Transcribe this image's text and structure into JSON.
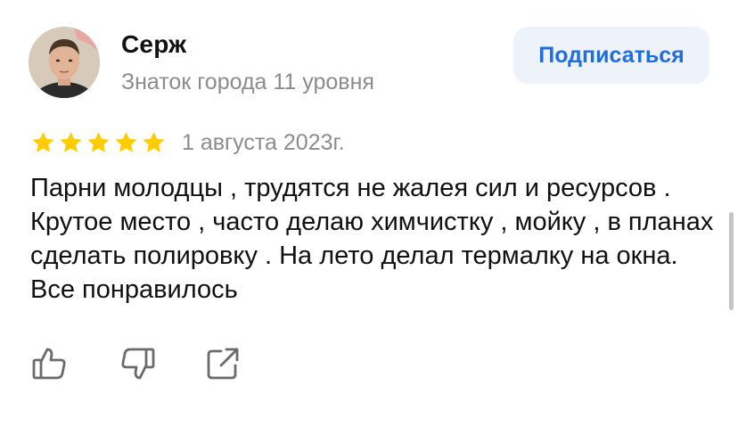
{
  "review": {
    "author": {
      "name": "Серж",
      "level": "Знаток города 11 уровня"
    },
    "subscribe_label": "Подписаться",
    "rating": 5,
    "rating_max": 5,
    "date": "1 августа 2023г.",
    "text": "Парни молодцы , трудятся не жалея сил и ресурсов . Крутое место , часто делаю химчистку , мойку , в планах сделать полировку . На лето делал термалку на окна. Все понравилось"
  },
  "icons": {
    "like": "thumbs-up-icon",
    "dislike": "thumbs-down-icon",
    "share": "share-icon",
    "star": "star-icon"
  },
  "colors": {
    "star": "#ffcc00",
    "accent": "#1f6ee0",
    "button_bg": "#eef3fb",
    "secondary_text": "#8c8c8c"
  }
}
